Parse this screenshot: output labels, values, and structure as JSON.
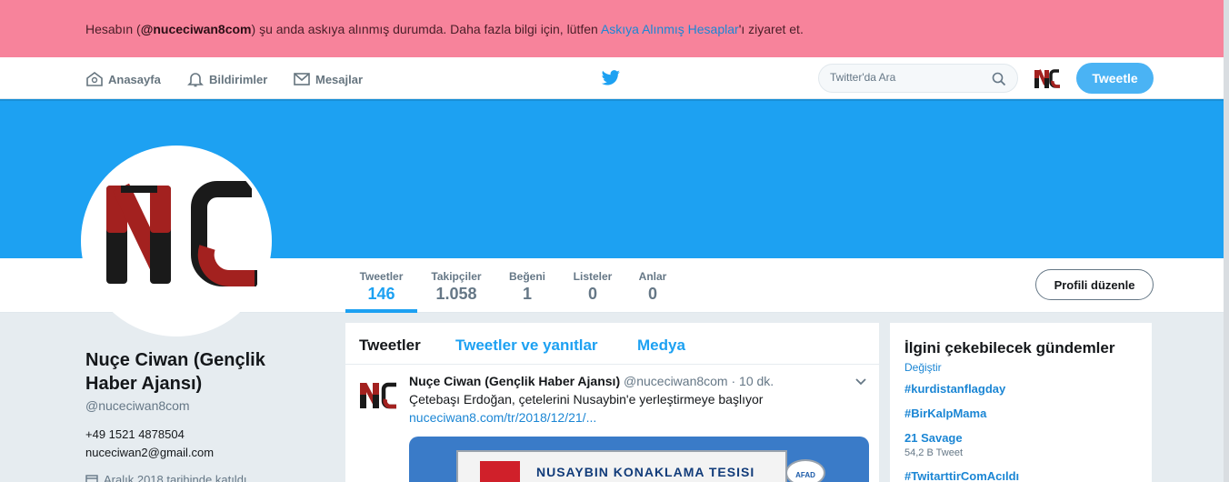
{
  "alert": {
    "prefix": "Hesabın (",
    "account": "@nuceciwan8com",
    "middle": ") şu anda askıya alınmış durumda. Daha fazla bilgi için, lütfen ",
    "link": "Askıya Alınmış Hesaplar",
    "suffix": "'ı ziyaret et."
  },
  "nav": {
    "home": "Anasayfa",
    "notifications": "Bildirimler",
    "messages": "Mesajlar",
    "search_placeholder": "Twitter'da Ara",
    "tweet_button": "Tweetle"
  },
  "stats": [
    {
      "label": "Tweetler",
      "value": "146"
    },
    {
      "label": "Takipçiler",
      "value": "1.058"
    },
    {
      "label": "Beğeni",
      "value": "1"
    },
    {
      "label": "Listeler",
      "value": "0"
    },
    {
      "label": "Anlar",
      "value": "0"
    }
  ],
  "edit_profile": "Profili düzenle",
  "avatar_text": "NC",
  "profile": {
    "name": "Nuçe Ciwan (Gençlik Haber Ajansı)",
    "handle": "@nuceciwan8com",
    "phone": "+49 1521 4878504",
    "email": "nuceciwan2@gmail.com",
    "joined": "Aralık 2018 tarihinde katıldı"
  },
  "tabs": [
    "Tweetler",
    "Tweetler ve yanıtlar",
    "Medya"
  ],
  "tweet": {
    "name": "Nuçe Ciwan (Gençlik Haber Ajansı)",
    "handle": "@nuceciwan8com",
    "time": "· 10 dk.",
    "text": "Çetebaşı Erdoğan, çetelerini Nusaybin'e yerleştirmeye başlıyor",
    "link": "nuceciwan8.com/tr/2018/12/21/...",
    "media_sign": "NUSAYBIN KONAKLAMA TESISI",
    "media_logo": "AFAD"
  },
  "trends": {
    "title": "İlgini çekebilecek gündemler",
    "change": "Değiştir",
    "items": [
      {
        "tag": "#kurdistanflagday",
        "meta": ""
      },
      {
        "tag": "#BirKalpMama",
        "meta": ""
      },
      {
        "tag": "21 Savage",
        "meta": "54,2 B Tweet"
      },
      {
        "tag": "#TwitarttirComAcıldı",
        "meta": ""
      }
    ]
  },
  "colors": {
    "alert_bg": "#f7839b",
    "banner": "#1da1f2",
    "accent": "#1da1f2",
    "link": "#1b86d4",
    "brand_red": "#a3211f",
    "brand_black": "#1a1a1a"
  },
  "icons": [
    "home-icon",
    "bell-icon",
    "envelope-icon",
    "twitter-bird-icon",
    "search-icon",
    "chevron-down-icon",
    "calendar-icon"
  ]
}
